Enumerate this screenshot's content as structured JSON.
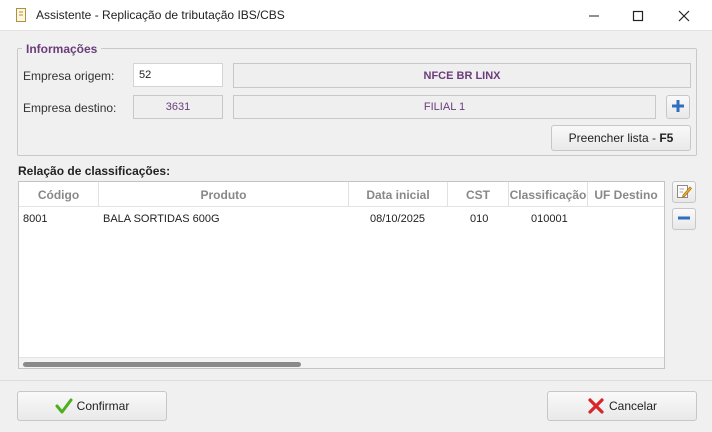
{
  "window": {
    "title": "Assistente - Replicação de tributação IBS/CBS",
    "icons": [
      "document-icon",
      "minimize-icon",
      "maximize-icon",
      "close-icon"
    ]
  },
  "info": {
    "legend": "Informações",
    "origem_label": "Empresa origem:",
    "origem_code": "52",
    "origem_name": "NFCE BR LINX",
    "destino_label": "Empresa destino:",
    "destino_code": "3631",
    "destino_name": "FILIAL 1",
    "fill_list_label": "Preencher lista - ",
    "fill_list_shortcut": "F5"
  },
  "list": {
    "title": "Relação de classificações:",
    "columns": [
      "Código",
      "Produto",
      "Data inicial",
      "CST",
      "Classificação",
      "UF Destino"
    ],
    "rows": [
      {
        "codigo": "8001",
        "produto": "BALA SORTIDAS 600G",
        "data_inicial": "08/10/2025",
        "cst": "010",
        "classificacao": "010001",
        "uf_destino": ""
      }
    ]
  },
  "actions": {
    "confirm_label": "Confirmar",
    "cancel_label": "Cancelar"
  },
  "colors": {
    "accent_purple": "#6a3d7a",
    "plus_blue": "#2f6fc0",
    "confirm_green": "#4caf1e",
    "cancel_red": "#d9242b"
  }
}
